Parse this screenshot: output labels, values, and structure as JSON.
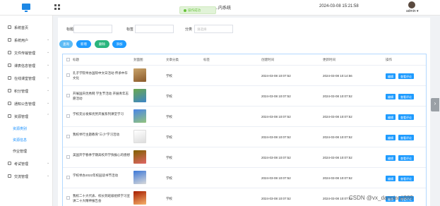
{
  "header": {
    "system_title": "...内系统",
    "datetime": "2024-03-08 15:21:58",
    "username": "admin"
  },
  "toast": {
    "message": "操作成功"
  },
  "sidebar": {
    "items": [
      {
        "label": "系统首页"
      },
      {
        "label": "系统用户"
      },
      {
        "label": "文件传输管理"
      },
      {
        "label": "课表信息管理"
      },
      {
        "label": "在线课堂管理"
      },
      {
        "label": "积分管理"
      },
      {
        "label": "通知公告管理"
      },
      {
        "label": "资源管理"
      }
    ],
    "subitems": [
      {
        "label": "资源类别"
      },
      {
        "label": "资源信息"
      },
      {
        "label": "作业管理"
      }
    ],
    "items_bottom": [
      {
        "label": "考试管理"
      },
      {
        "label": "交流管理"
      }
    ]
  },
  "filters": {
    "title_label": "标题",
    "tag_label": "标签",
    "category_label": "分类",
    "category_placeholder": "请选择"
  },
  "buttons": {
    "search": "查询",
    "add": "新增",
    "delete": "删除",
    "extra": "添加"
  },
  "table": {
    "headers": {
      "title": "标题",
      "cover": "封面图",
      "category": "文章分类",
      "tag": "标签",
      "created": "创建时间",
      "updated": "更新时间",
      "actions": "操作"
    },
    "rows": [
      {
        "title": "孔子学院举办国际中文日活动 传承中华文化",
        "category": "学校",
        "tag": "",
        "created": "2024-03-08 10:07:52",
        "updated": "2024-03-08 10:14:56",
        "edit": "编辑",
        "view": "查看评论"
      },
      {
        "title": "开展国庆优秀网 学生节活动 开展青年志愿活动",
        "category": "学校",
        "tag": "",
        "created": "2024-03-08 10:07:52",
        "updated": "2024-03-08 10:07:52",
        "edit": "编辑",
        "view": "查看评论"
      },
      {
        "title": "学校充分发挥优势开展系列课堂学习",
        "category": "学校",
        "tag": "",
        "created": "2024-03-08 10:07:52",
        "updated": "2024-03-08 10:07:52",
        "edit": "编辑",
        "view": "查看评论"
      },
      {
        "title": "我校举行主题教育“三小”学习活动",
        "category": "学校",
        "tag": "",
        "created": "2024-03-08 10:07:52",
        "updated": "2024-03-08 10:07:52",
        "edit": "编辑",
        "view": "查看评论"
      },
      {
        "title": "美国开学春季学期高校开学快报心的感想",
        "category": "学校",
        "tag": "",
        "created": "2024-03-08 10:07:52",
        "updated": "2024-03-08 10:07:52",
        "edit": "编辑",
        "view": "查看评论"
      },
      {
        "title": "学校举办2022年校园读书节活动",
        "category": "学校",
        "tag": "",
        "created": "2024-03-08 10:07:52",
        "updated": "2024-03-08 10:07:52",
        "edit": "编辑",
        "view": "查看评论"
      },
      {
        "title": "我校二十大代表、校长到班级组织学习宣讲二十大精神报告会",
        "category": "学校",
        "tag": "",
        "created": "2024-03-08 10:07:52",
        "updated": "2024-03-08 10:07:52",
        "edit": "编辑",
        "view": "查看评论"
      }
    ]
  },
  "watermark": "CSDN @vx_danpianji889",
  "colors": {
    "primary": "#1e9bff",
    "green": "#2ab57d",
    "success": "#67c23a"
  }
}
